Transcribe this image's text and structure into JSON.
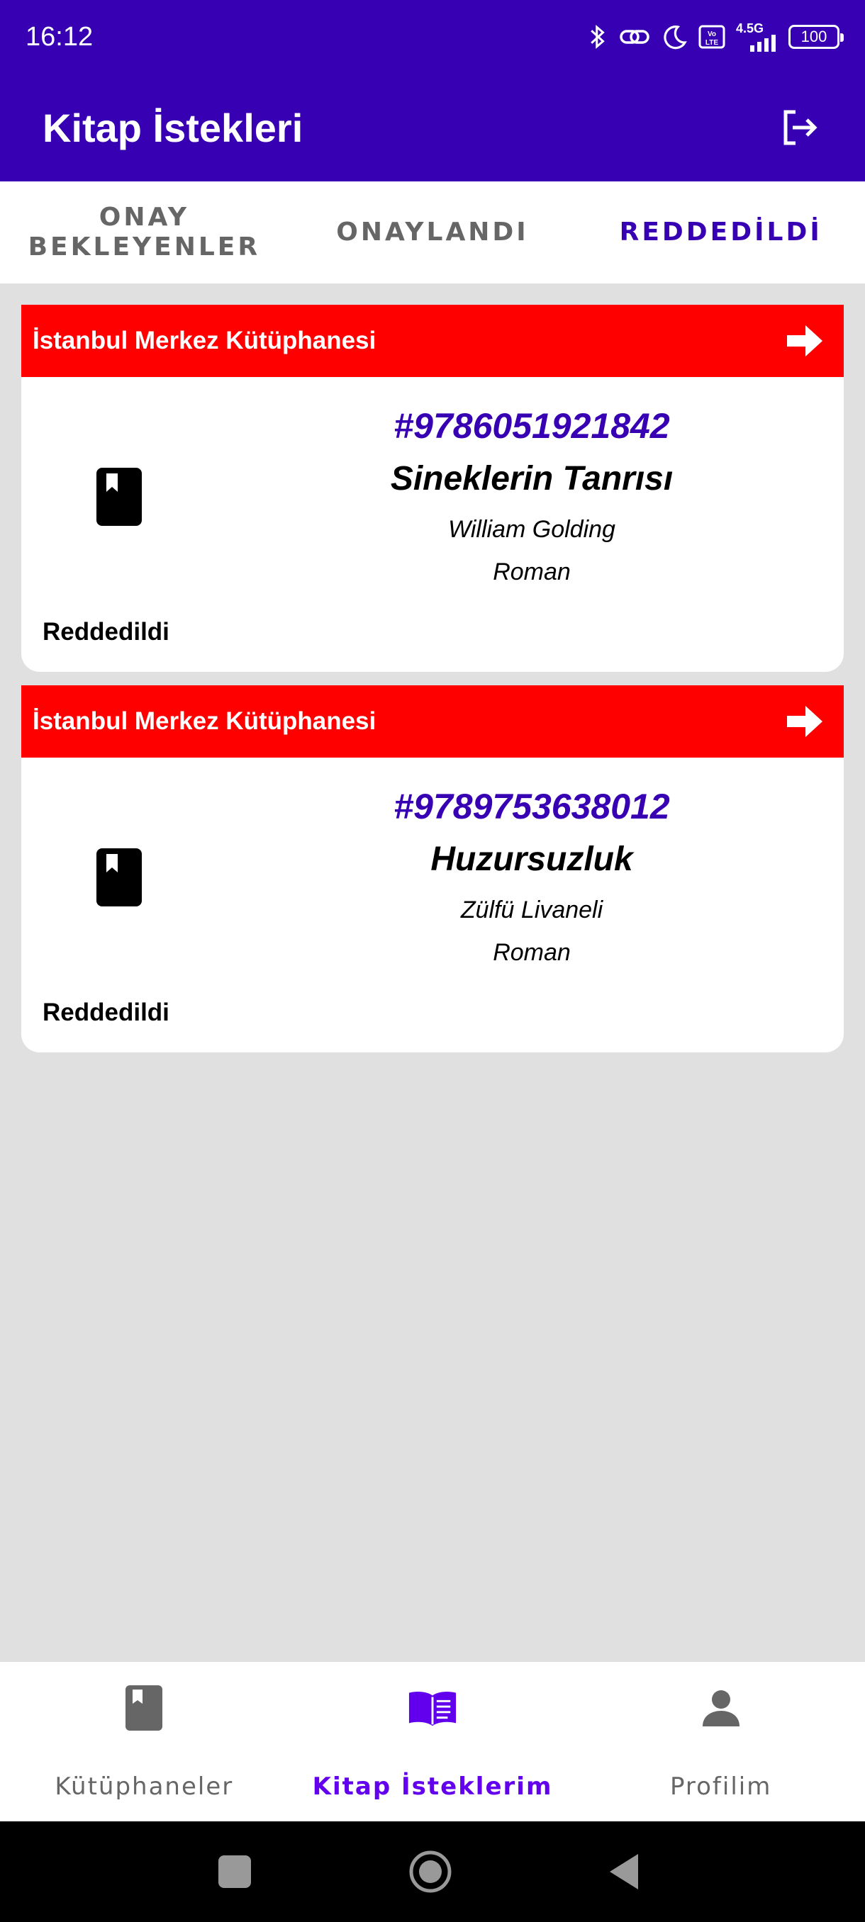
{
  "status_bar": {
    "time": "16:12",
    "network": "4.5G",
    "battery": "100"
  },
  "app_bar": {
    "title": "Kitap İstekleri"
  },
  "tabs": [
    {
      "label": "ONAY\nBEKLEYENLER",
      "active": false
    },
    {
      "label": "ONAYLANDI",
      "active": false
    },
    {
      "label": "REDDEDİLDİ",
      "active": true
    }
  ],
  "requests": [
    {
      "library": "İstanbul Merkez Kütüphanesi",
      "isbn": "#9786051921842",
      "title": "Sineklerin Tanrısı",
      "author": "William Golding",
      "genre": "Roman",
      "status": "Reddedildi"
    },
    {
      "library": "İstanbul Merkez Kütüphanesi",
      "isbn": "#9789753638012",
      "title": "Huzursuzluk",
      "author": "Zülfü Livaneli",
      "genre": "Roman",
      "status": "Reddedildi"
    }
  ],
  "bottom_nav": [
    {
      "label": "Kütüphaneler",
      "icon": "book-icon",
      "active": false
    },
    {
      "label": "Kitap İsteklerim",
      "icon": "open-book-icon",
      "active": true
    },
    {
      "label": "Profilim",
      "icon": "person-icon",
      "active": false
    }
  ],
  "colors": {
    "primary": "#3700b3",
    "active_nav": "#6200ee",
    "header_red": "#ff0000"
  }
}
